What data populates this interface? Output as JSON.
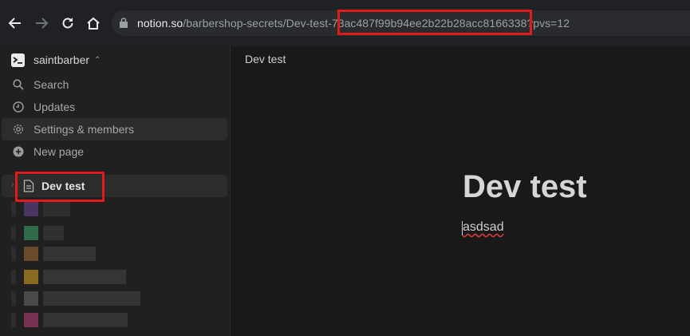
{
  "browser": {
    "url_host": "notion.so",
    "url_path": "/barbershop-secrets/Dev-test-73ac487f99b94ee2b22b28acc8166338?pvs=12",
    "icons": [
      "back-icon",
      "forward-icon",
      "reload-icon",
      "home-icon",
      "lock-icon"
    ]
  },
  "sidebar": {
    "workspace_name": "saintbarber",
    "items": [
      {
        "label": "Search",
        "icon": "search-icon"
      },
      {
        "label": "Updates",
        "icon": "clock-icon"
      },
      {
        "label": "Settings & members",
        "icon": "gear-icon"
      },
      {
        "label": "New page",
        "icon": "plus-circle-icon"
      }
    ],
    "pages": [
      {
        "label": "Dev test",
        "icon": "page-icon"
      }
    ]
  },
  "main": {
    "breadcrumb": "Dev test",
    "title": "Dev test",
    "body": "asdsad"
  },
  "colors": {
    "highlight": "#e01b1b",
    "sidebar_bg": "#202020",
    "main_bg": "#191919"
  }
}
